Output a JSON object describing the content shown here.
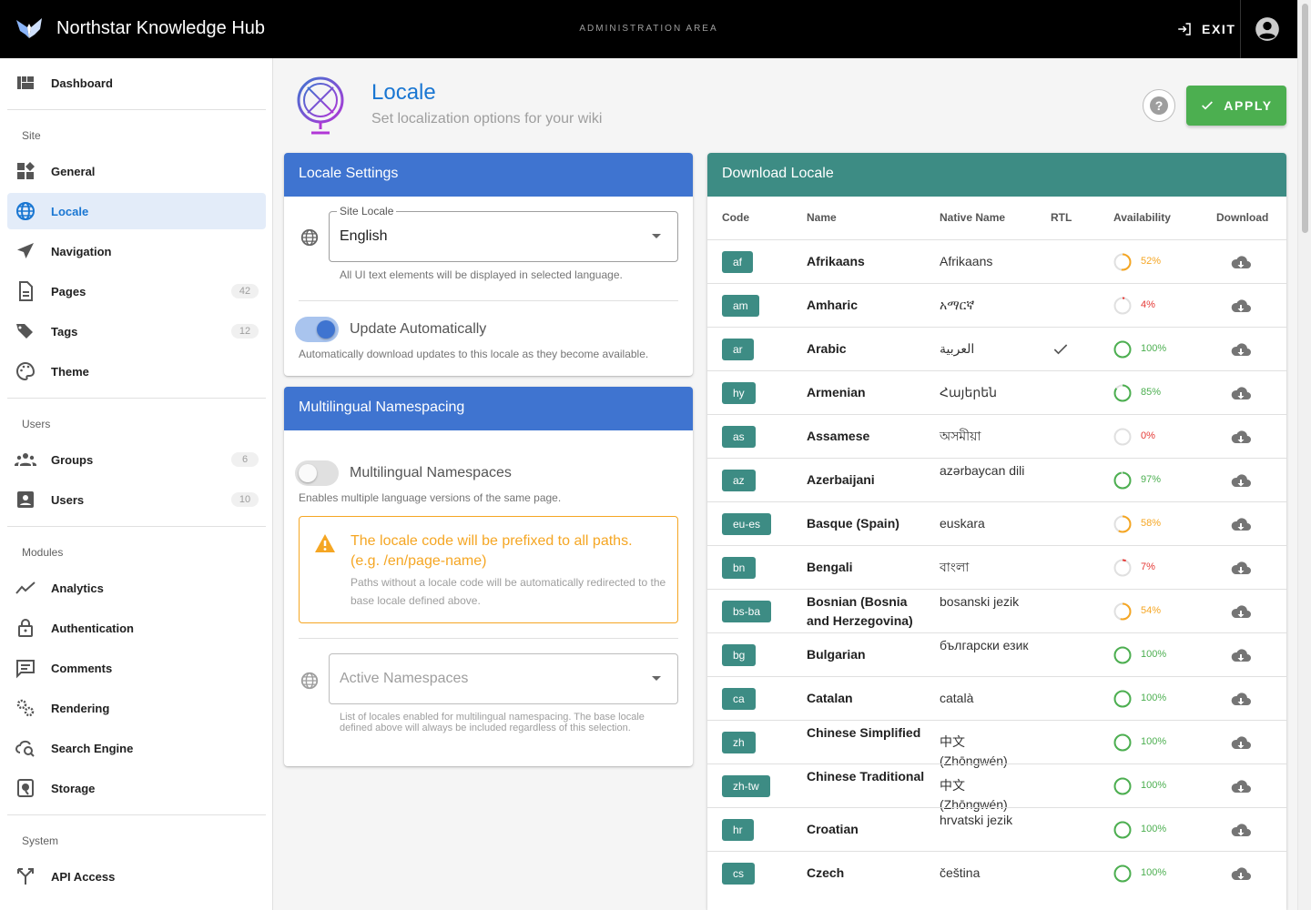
{
  "header": {
    "app_title": "Northstar Knowledge Hub",
    "area_label": "ADMINISTRATION AREA",
    "exit_label": "EXIT"
  },
  "sidebar": {
    "items": [
      {
        "label": "Dashboard",
        "icon": "dashboard-icon"
      },
      {
        "label": "General",
        "icon": "widgets-icon"
      },
      {
        "label": "Locale",
        "icon": "globe-icon",
        "active": true
      },
      {
        "label": "Navigation",
        "icon": "navigation-arrow-icon"
      },
      {
        "label": "Pages",
        "icon": "page-icon",
        "badge": "42"
      },
      {
        "label": "Tags",
        "icon": "tags-icon",
        "badge": "12"
      },
      {
        "label": "Theme",
        "icon": "palette-icon"
      },
      {
        "label": "Groups",
        "icon": "groups-icon",
        "badge": "6"
      },
      {
        "label": "Users",
        "icon": "user-card-icon",
        "badge": "10"
      },
      {
        "label": "Analytics",
        "icon": "trend-line-icon"
      },
      {
        "label": "Authentication",
        "icon": "lock-icon"
      },
      {
        "label": "Comments",
        "icon": "comment-icon"
      },
      {
        "label": "Rendering",
        "icon": "gears-icon"
      },
      {
        "label": "Search Engine",
        "icon": "cloud-search-icon"
      },
      {
        "label": "Storage",
        "icon": "storage-icon"
      },
      {
        "label": "API Access",
        "icon": "api-icon"
      }
    ],
    "sections": {
      "site": "Site",
      "users": "Users",
      "modules": "Modules",
      "system": "System"
    }
  },
  "page": {
    "title": "Locale",
    "subtitle": "Set localization options for your wiki",
    "apply_label": "APPLY"
  },
  "locale_settings": {
    "title": "Locale Settings",
    "site_locale_label": "Site Locale",
    "site_locale_value": "English",
    "site_locale_hint": "All UI text elements will be displayed in selected language.",
    "auto_update_label": "Update Automatically",
    "auto_update_on": true,
    "auto_update_hint": "Automatically download updates to this locale as they become available."
  },
  "namespacing": {
    "title": "Multilingual Namespacing",
    "toggle_label": "Multilingual Namespaces",
    "toggle_on": false,
    "toggle_hint": "Enables multiple language versions of the same page.",
    "alert_title": "The locale code will be prefixed to all paths. (e.g. /en/page-name)",
    "alert_text": "Paths without a locale code will be automatically redirected to the base locale defined above.",
    "active_placeholder": "Active Namespaces",
    "active_hint": "List of locales enabled for multilingual namespacing. The base locale defined above will always be included regardless of this selection."
  },
  "download_locale": {
    "title": "Download Locale",
    "columns": [
      "Code",
      "Name",
      "Native Name",
      "RTL",
      "Availability",
      "Download"
    ],
    "rows": [
      {
        "code": "af",
        "name": "Afrikaans",
        "native": "Afrikaans",
        "rtl": false,
        "availability": 52,
        "pct": "52%"
      },
      {
        "code": "am",
        "name": "Amharic",
        "native": "አማርኛ",
        "rtl": false,
        "availability": 4,
        "pct": "4%"
      },
      {
        "code": "ar",
        "name": "Arabic",
        "native": "العربية",
        "rtl": true,
        "availability": 100,
        "pct": "100%"
      },
      {
        "code": "hy",
        "name": "Armenian",
        "native": "Հայերեն",
        "rtl": false,
        "availability": 85,
        "pct": "85%"
      },
      {
        "code": "as",
        "name": "Assamese",
        "native": "অসমীয়া",
        "rtl": false,
        "availability": 0,
        "pct": "0%"
      },
      {
        "code": "az",
        "name": "Azerbaijani",
        "native": "azərbaycan dili",
        "rtl": false,
        "availability": 97,
        "pct": "97%"
      },
      {
        "code": "eu-es",
        "name": "Basque (Spain)",
        "native": "euskara",
        "rtl": false,
        "availability": 58,
        "pct": "58%"
      },
      {
        "code": "bn",
        "name": "Bengali",
        "native": "বাংলা",
        "rtl": false,
        "availability": 7,
        "pct": "7%"
      },
      {
        "code": "bs-ba",
        "name": "Bosnian (Bosnia and Herzegovina)",
        "native": "bosanski jezik",
        "rtl": false,
        "availability": 54,
        "pct": "54%"
      },
      {
        "code": "bg",
        "name": "Bulgarian",
        "native": "български език",
        "rtl": false,
        "availability": 100,
        "pct": "100%"
      },
      {
        "code": "ca",
        "name": "Catalan",
        "native": "català",
        "rtl": false,
        "availability": 100,
        "pct": "100%"
      },
      {
        "code": "zh",
        "name": "Chinese Simplified",
        "native": "中文 (Zhōngwén)",
        "rtl": false,
        "availability": 100,
        "pct": "100%"
      },
      {
        "code": "zh-tw",
        "name": "Chinese Traditional",
        "native": "中文 (Zhōngwén)",
        "rtl": false,
        "availability": 100,
        "pct": "100%"
      },
      {
        "code": "hr",
        "name": "Croatian",
        "native": "hrvatski jezik",
        "rtl": false,
        "availability": 100,
        "pct": "100%"
      },
      {
        "code": "cs",
        "name": "Czech",
        "native": "čeština",
        "rtl": false,
        "availability": 100,
        "pct": "100%"
      }
    ]
  },
  "colors": {
    "accent": "#1976d2",
    "card_header_blue": "#3f74d0",
    "card_header_teal": "#3d8c84",
    "apply_green": "#4caf50",
    "warning_orange": "#f5a623",
    "avail_high": "#4caf50",
    "avail_mid": "#f5a623",
    "avail_low": "#e53935"
  }
}
